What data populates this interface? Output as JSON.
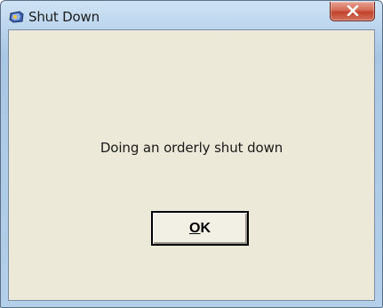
{
  "window": {
    "title": "Shut Down",
    "icon": "app-icon",
    "close_icon": "close-icon"
  },
  "dialog": {
    "message": "Doing an orderly shut down",
    "ok_button": {
      "mnemonic": "O",
      "rest": "K"
    }
  },
  "colors": {
    "client_background": "#ece9d8",
    "close_button": "#c2432c",
    "title_bar": "#bcd6ee"
  }
}
